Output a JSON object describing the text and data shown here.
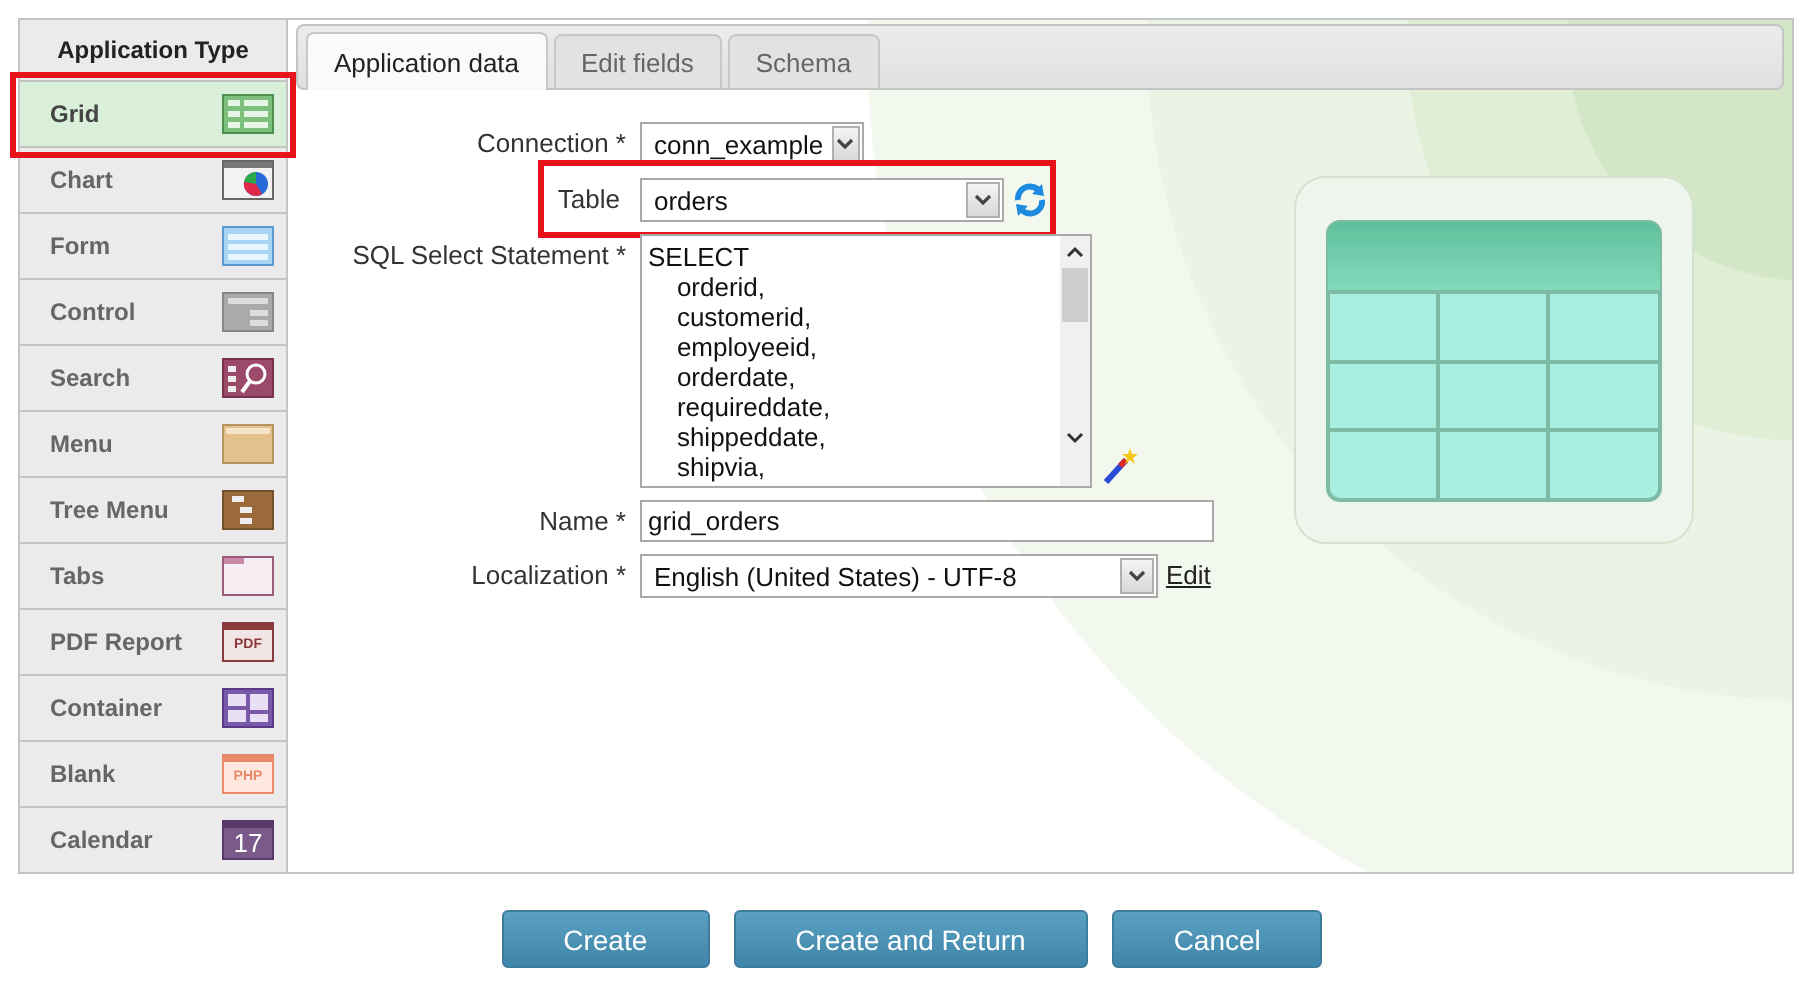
{
  "sidebar": {
    "title": "Application Type",
    "items": [
      {
        "label": "Grid",
        "kind": "grid",
        "selected": true
      },
      {
        "label": "Chart",
        "kind": "chart",
        "selected": false
      },
      {
        "label": "Form",
        "kind": "form",
        "selected": false
      },
      {
        "label": "Control",
        "kind": "control",
        "selected": false
      },
      {
        "label": "Search",
        "kind": "search",
        "selected": false
      },
      {
        "label": "Menu",
        "kind": "menu",
        "selected": false
      },
      {
        "label": "Tree Menu",
        "kind": "tree",
        "selected": false
      },
      {
        "label": "Tabs",
        "kind": "tabs",
        "selected": false
      },
      {
        "label": "PDF Report",
        "kind": "pdf",
        "selected": false,
        "icon_text": "PDF"
      },
      {
        "label": "Container",
        "kind": "container",
        "selected": false
      },
      {
        "label": "Blank",
        "kind": "blank",
        "selected": false,
        "icon_text": "PHP"
      },
      {
        "label": "Calendar",
        "kind": "calendar",
        "selected": false,
        "icon_text": "17"
      }
    ]
  },
  "tabs": [
    {
      "label": "Application data",
      "selected": true
    },
    {
      "label": "Edit fields",
      "selected": false
    },
    {
      "label": "Schema",
      "selected": false
    }
  ],
  "form": {
    "fields": [
      {
        "label": "Connection *",
        "kind": "select",
        "value": "conn_example",
        "highlighted": false
      },
      {
        "label": "Table",
        "kind": "select-refresh",
        "value": "orders",
        "highlighted": true
      },
      {
        "label": "SQL Select Statement *",
        "kind": "textarea-wizard",
        "lines": [
          "SELECT",
          "    orderid,",
          "    customerid,",
          "    employeeid,",
          "    orderdate,",
          "    requireddate,",
          "    shippeddate,",
          "    shipvia,"
        ],
        "highlighted": false
      },
      {
        "label": "Name *",
        "kind": "input",
        "value": "grid_orders",
        "highlighted": false
      },
      {
        "label": "Localization *",
        "kind": "select",
        "value": "English (United States) - UTF-8",
        "link": "Edit",
        "highlighted": false
      }
    ]
  },
  "buttons": [
    "Create",
    "Create and Return",
    "Cancel"
  ]
}
